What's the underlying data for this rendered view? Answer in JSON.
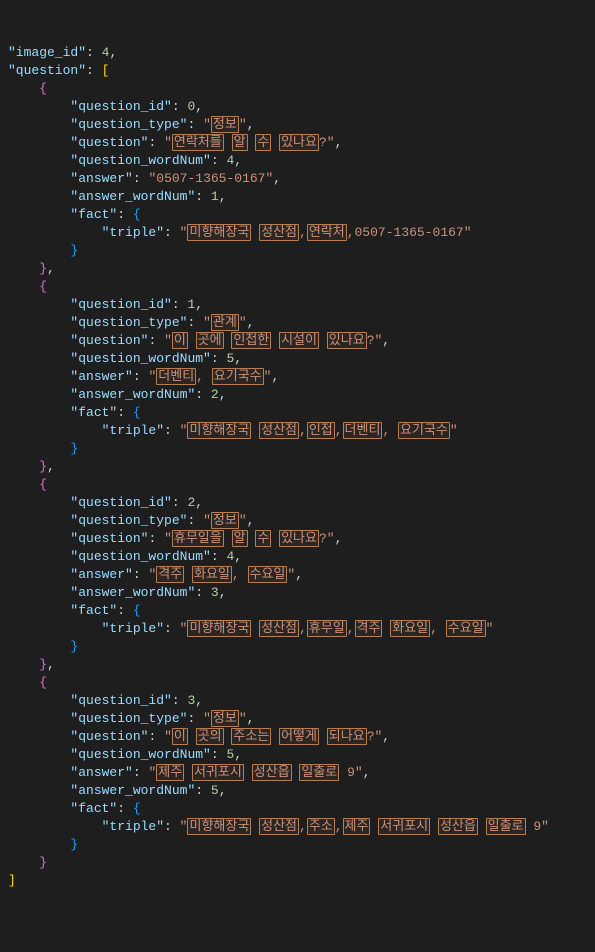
{
  "header": {
    "image_id_key": "\"image_id\"",
    "image_id_val": "4",
    "question_key": "\"question\"",
    "comma": ",",
    "colon": ":",
    "space": " ",
    "open_brace_y": "{",
    "close_brace_y": "}",
    "open_bracket_p": "[",
    "close_bracket_p": "]",
    "open_brace_p": "{",
    "close_brace_p": "}",
    "open_brace_b": "{",
    "close_brace_b": "}"
  },
  "q0": {
    "qid_key": "\"question_id\"",
    "qid_val": "0",
    "qtype_key": "\"question_type\"",
    "qtype_q": "\"",
    "qtype_ime": "정보",
    "question_key": "\"question\"",
    "q_q": "\"",
    "q_ime1": "연락처를",
    "q_ime2": "알",
    "q_ime3": "수",
    "q_ime4": "있나요",
    "q_tail": "?\"",
    "qwn_key": "\"question_wordNum\"",
    "qwn_val": "4",
    "ans_key": "\"answer\"",
    "ans_val": "\"0507-1365-0167\"",
    "awn_key": "\"answer_wordNum\"",
    "awn_val": "1",
    "fact_key": "\"fact\"",
    "triple_key": "\"triple\"",
    "t_q": "\"",
    "t_ime1": "미향해장국",
    "t_ime2": "성산점",
    "t_sep1": ",",
    "t_ime3": "연락처",
    "t_tail": ",0507-1365-0167\""
  },
  "q1": {
    "qid_key": "\"question_id\"",
    "qid_val": "1",
    "qtype_key": "\"question_type\"",
    "qtype_q": "\"",
    "qtype_ime": "관계",
    "question_key": "\"question\"",
    "q_q": "\"",
    "q_ime1": "이",
    "q_ime2": "곳에",
    "q_ime3": "인접한",
    "q_ime4": "시설이",
    "q_ime5": "있나요",
    "q_tail": "?\"",
    "qwn_key": "\"question_wordNum\"",
    "qwn_val": "5",
    "ans_key": "\"answer\"",
    "a_q": "\"",
    "a_ime1": "더벤티",
    "a_sep": ", ",
    "a_ime2": "요기국수",
    "awn_key": "\"answer_wordNum\"",
    "awn_val": "2",
    "fact_key": "\"fact\"",
    "triple_key": "\"triple\"",
    "t_q": "\"",
    "t_ime1": "미향해장국",
    "t_ime2": "성산점",
    "t_sep1": ",",
    "t_ime3": "인접",
    "t_sep2": ",",
    "t_ime4": "더벤티",
    "t_sep3": ", ",
    "t_ime5": "요기국수"
  },
  "q2": {
    "qid_key": "\"question_id\"",
    "qid_val": "2",
    "qtype_key": "\"question_type\"",
    "qtype_q": "\"",
    "qtype_ime": "정보",
    "question_key": "\"question\"",
    "q_q": "\"",
    "q_ime1": "휴무일을",
    "q_ime2": "알",
    "q_ime3": "수",
    "q_ime4": "있나요",
    "q_tail": "?\"",
    "qwn_key": "\"question_wordNum\"",
    "qwn_val": "4",
    "ans_key": "\"answer\"",
    "a_q": "\"",
    "a_ime1": "격주",
    "a_ime2": "화요일",
    "a_sep": ", ",
    "a_ime3": "수요일",
    "awn_key": "\"answer_wordNum\"",
    "awn_val": "3",
    "fact_key": "\"fact\"",
    "triple_key": "\"triple\"",
    "t_q": "\"",
    "t_ime1": "미향해장국",
    "t_ime2": "성산점",
    "t_sep1": ",",
    "t_ime3": "휴무일",
    "t_sep2": ",",
    "t_ime4": "격주",
    "t_ime5": "화요일",
    "t_sep3": ", ",
    "t_ime6": "수요일"
  },
  "q3": {
    "qid_key": "\"question_id\"",
    "qid_val": "3",
    "qtype_key": "\"question_type\"",
    "qtype_q": "\"",
    "qtype_ime": "정보",
    "question_key": "\"question\"",
    "q_q": "\"",
    "q_ime1": "이",
    "q_ime2": "곳의",
    "q_ime3": "주소는",
    "q_ime4": "어떻게",
    "q_ime5": "되나요",
    "q_tail": "?\"",
    "qwn_key": "\"question_wordNum\"",
    "qwn_val": "5",
    "ans_key": "\"answer\"",
    "a_q": "\"",
    "a_ime1": "제주",
    "a_ime2": "서귀포시",
    "a_ime3": "성산읍",
    "a_ime4": "일출로",
    "a_tail": " 9\"",
    "awn_key": "\"answer_wordNum\"",
    "awn_val": "5",
    "fact_key": "\"fact\"",
    "triple_key": "\"triple\"",
    "t_q": "\"",
    "t_ime1": "미향해장국",
    "t_ime2": "성산점",
    "t_sep1": ",",
    "t_ime3": "주소",
    "t_sep2": ",",
    "t_ime4": "제주",
    "t_ime5": "서귀포시",
    "t_ime6": "성산읍",
    "t_ime7": "일출로",
    "t_tail": " 9\""
  }
}
